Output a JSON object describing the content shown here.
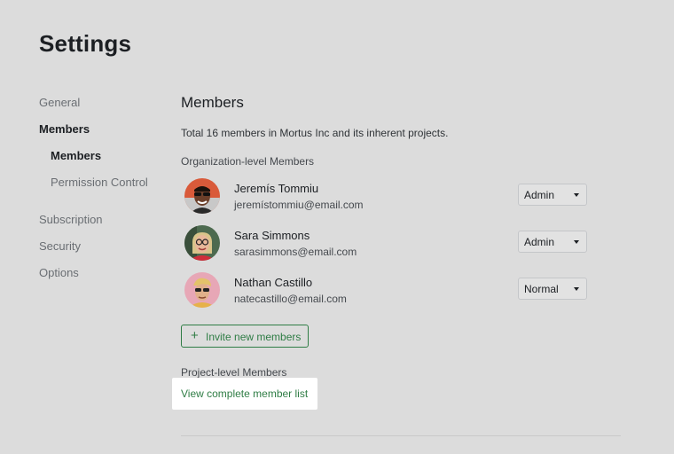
{
  "page": {
    "title": "Settings"
  },
  "sidebar": {
    "items": [
      {
        "label": "General"
      },
      {
        "label": "Members"
      },
      {
        "label": "Members"
      },
      {
        "label": "Permission Control"
      },
      {
        "label": "Subscription"
      },
      {
        "label": "Security"
      },
      {
        "label": "Options"
      }
    ]
  },
  "main": {
    "section_title": "Members",
    "summary": "Total 16 members in Mortus Inc and its inherent projects.",
    "org_label": "Organization-level Members",
    "members": [
      {
        "name": "Jeremís Tommiu",
        "email": "jeremístommiu@email.com",
        "role": "Admin",
        "avatar": "avatar-man-sunglasses"
      },
      {
        "name": "Sara Simmons",
        "email": "sarasimmons@email.com",
        "role": "Admin",
        "avatar": "avatar-woman-glasses"
      },
      {
        "name": "Nathan Castillo",
        "email": "natecastillo@email.com",
        "role": "Normal",
        "avatar": "avatar-man-blond-sunglasses"
      }
    ],
    "invite_button": {
      "icon": "plus-icon",
      "label": "Invite new members"
    },
    "project_label": "Project-level Members",
    "view_link": "View complete member list"
  },
  "colors": {
    "background": "#dcdcdc",
    "accent_green": "#2f7d45",
    "highlight": "#ffffff"
  }
}
